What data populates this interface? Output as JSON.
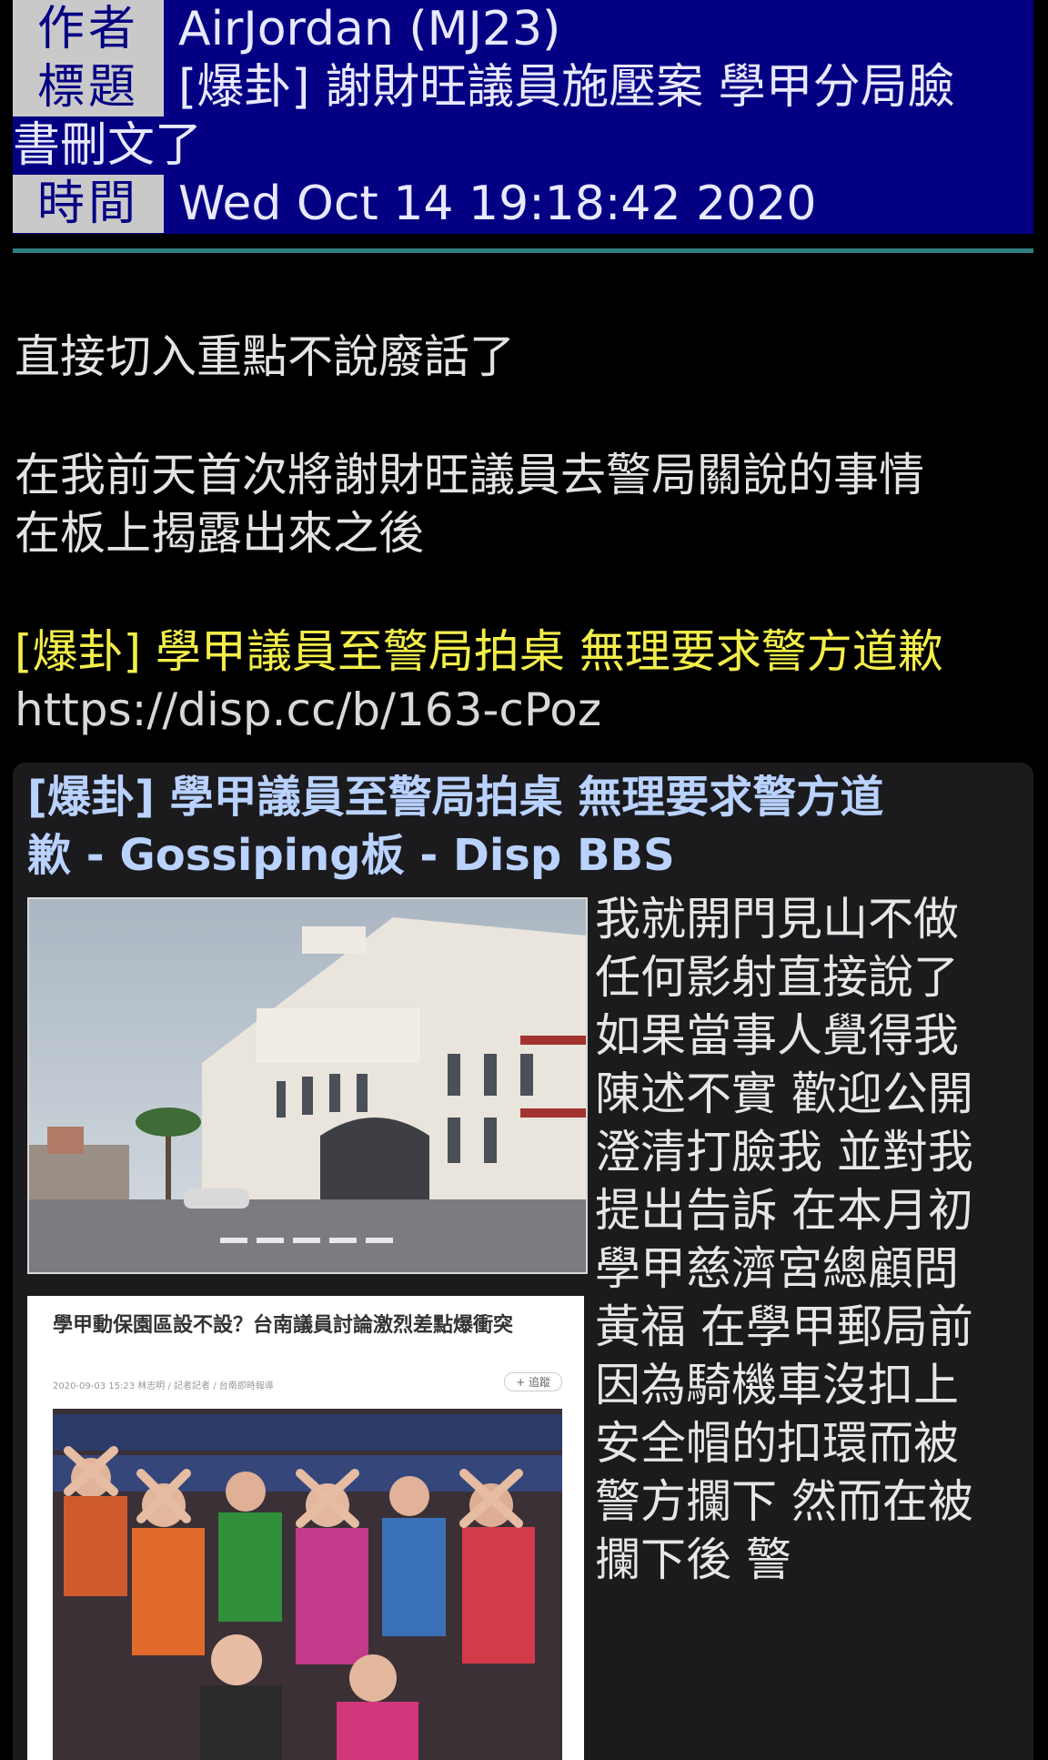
{
  "header": {
    "author_label": "作者",
    "author_value": "AirJordan (MJ23)",
    "title_label": "標題",
    "title_value_line1": "[爆卦] 謝財旺議員施壓案 學甲分局臉",
    "title_value_line2": "書刪文了",
    "time_label": "時間",
    "time_value": "Wed Oct 14 19:18:42 2020"
  },
  "body": {
    "line1": "直接切入重點不說廢話了",
    "line2": "在我前天首次將謝財旺議員去警局關說的事情",
    "line3": "在板上揭露出來之後",
    "highlight": "[爆卦] 學甲議員至警局拍桌 無理要求警方道歉",
    "url": "https://disp.cc/b/163-cPoz"
  },
  "card": {
    "title_line1": "[爆卦] 學甲議員至警局拍桌 無理要求警方道",
    "title_line2": "歉 - Gossiping板 - Disp BBS",
    "text_lines": [
      " 我就開門見山不做",
      "任何影射直接說了",
      "如果當事人覺得我",
      "陳述不實 歡迎公開",
      "澄清打臉我 並對我",
      "提出告訴 在本月初",
      "學甲慈濟宮總顧問",
      "黃福 在學甲郵局前",
      "因為騎機車沒扣上",
      "安全帽的扣環而被",
      "警方攔下 然而在被",
      "攔下後 警"
    ],
    "news_headline": "學甲動保園區設不設？台南議員討論激烈差點爆衝突",
    "news_meta": "2020-09-03 15:23  林志明 / 記者記者 / 台南即時報導",
    "news_tag": "+ 追蹤"
  },
  "colors": {
    "header_bg": "#050083",
    "label_bg": "#c9c9c9",
    "divider": "#2f7f82",
    "highlight": "#f2ee4a",
    "card_title": "#b9d2ff"
  }
}
